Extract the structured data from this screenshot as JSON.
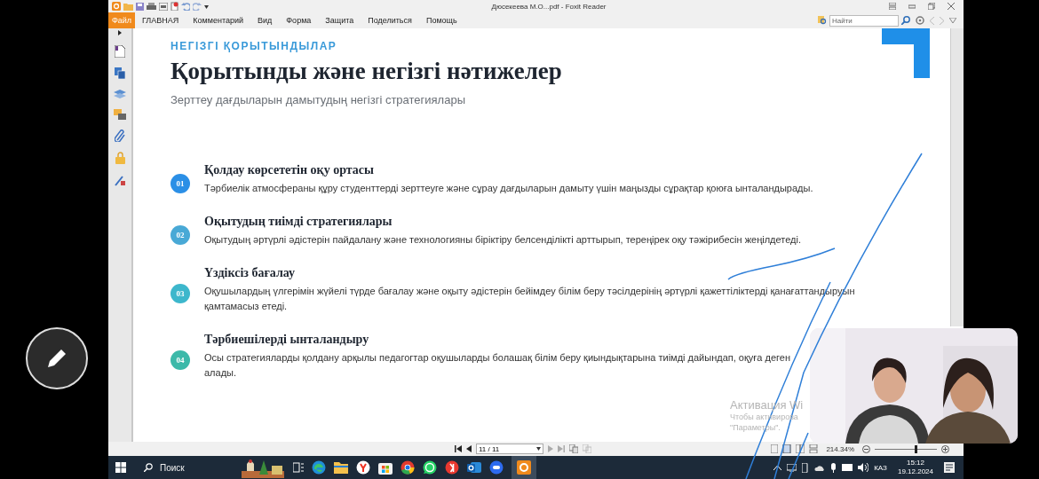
{
  "window": {
    "title": "Дюсекеева М.О...pdf - Foxit Reader"
  },
  "menu_tabs": [
    {
      "label": "Файл",
      "selected": true
    },
    {
      "label": "ГЛАВНАЯ",
      "selected": false
    },
    {
      "label": "Комментарий",
      "selected": false
    },
    {
      "label": "Вид",
      "selected": false
    },
    {
      "label": "Форма",
      "selected": false
    },
    {
      "label": "Защита",
      "selected": false
    },
    {
      "label": "Поделиться",
      "selected": false
    },
    {
      "label": "Помощь",
      "selected": false
    }
  ],
  "search": {
    "placeholder": "Найти"
  },
  "slide": {
    "eyebrow": "НЕГІЗГІ ҚОРЫТЫНДЫЛАР",
    "title": "Қорытынды және негізгі нәтижелер",
    "subtitle": "Зерттеу дағдыларын дамытудың негізгі стратегиялары",
    "items": [
      {
        "number": "01",
        "color": "#2b8fe6",
        "heading": "Қолдау көрсететін оқу ортасы",
        "lines": [
          "Тәрбиелік атмосфераны құру студенттерді зерттеуге және сұрау дағдыларын дамыту үшін маңызды сұрақтар қоюға ынталандырады."
        ]
      },
      {
        "number": "02",
        "color": "#49a9d6",
        "heading": "Оқытудың тиімді стратегиялары",
        "lines": [
          "Оқытудың әртүрлі әдістерін пайдалану және технологияны біріктіру белсенділікті арттырып, тереңірек оқу тәжірибесін жеңілдетеді."
        ]
      },
      {
        "number": "03",
        "color": "#3db7cc",
        "heading": "Үздіксіз бағалау",
        "lines": [
          "Оқушылардың үлгерімін жүйелі түрде бағалау және оқыту әдістерін бейімдеу білім беру тәсілдерінің әртүрлі қажеттіліктерді қанағаттандыруын",
          "қамтамасыз етеді."
        ]
      },
      {
        "number": "04",
        "color": "#3cb9a9",
        "heading": "Тәрбиешілерді ынталандыру",
        "lines": [
          "Осы стратегияларды қолдану арқылы педагогтар оқушыларды болашақ білім беру қиындықтарына тиімді дайындап, оқуға деген",
          "алады."
        ]
      }
    ]
  },
  "activation_notice": {
    "title": "Активация Wi",
    "lines": [
      "Чтобы активирова",
      "\"Параметры\"."
    ]
  },
  "status_bar": {
    "page": "11 / 11",
    "zoom": "214.34%",
    "zoom_slider": {
      "level": 0.64
    }
  },
  "taskbar": {
    "search": "Поиск",
    "language": "КАЗ",
    "time": "15:12",
    "date": "19.12.2024"
  }
}
